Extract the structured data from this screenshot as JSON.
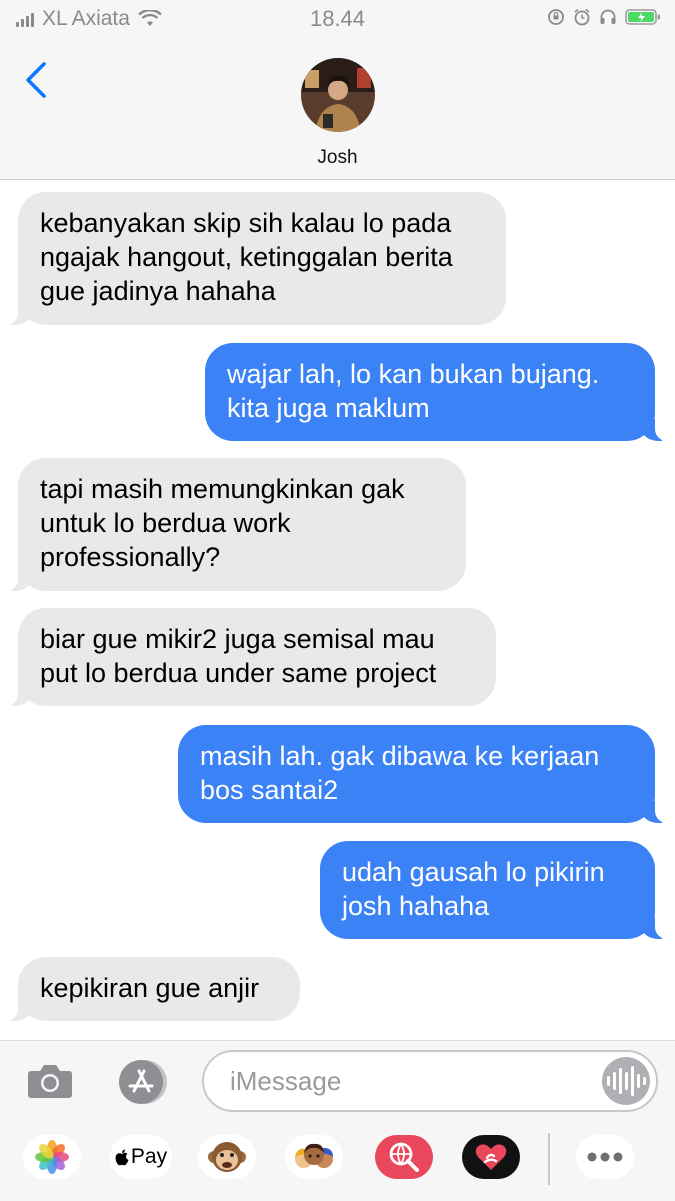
{
  "status_bar": {
    "carrier": "XL Axiata",
    "time": "18.44"
  },
  "header": {
    "contact_name": "Josh"
  },
  "messages": [
    {
      "from": "them",
      "text": "kebanyakan skip sih kalau lo pada ngajak hangout, ketinggalan berita gue jadinya hahaha"
    },
    {
      "from": "me",
      "text": "wajar lah, lo kan bukan bujang. kita juga maklum"
    },
    {
      "from": "them",
      "text": "tapi masih memungkinkan gak untuk lo berdua work professionally?"
    },
    {
      "from": "them",
      "text": "biar gue mikir2 juga semisal mau put lo berdua under same project"
    },
    {
      "from": "me",
      "text": "masih lah. gak dibawa ke kerjaan bos santai2"
    },
    {
      "from": "me",
      "text": "udah gausah lo pikirin josh hahaha"
    },
    {
      "from": "them",
      "text": "kepikiran gue anjir"
    }
  ],
  "composer": {
    "placeholder": "iMessage"
  },
  "app_drawer": {
    "apple_pay_label": "Pay"
  },
  "colors": {
    "outgoing": "#3b82f6",
    "incoming": "#e9e9eb",
    "accent": "#0a7aff"
  }
}
